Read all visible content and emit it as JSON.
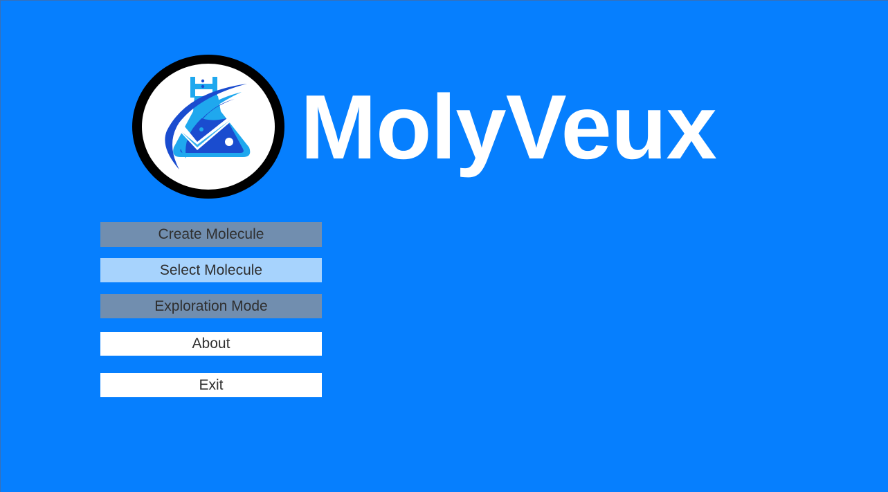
{
  "app": {
    "title": "MolyVeux",
    "logo_icon": "flask-check-logo-icon"
  },
  "menu": {
    "items": [
      {
        "label": "Create Molecule",
        "state": "disabled"
      },
      {
        "label": "Select Molecule",
        "state": "highlighted"
      },
      {
        "label": "Exploration Mode",
        "state": "disabled"
      },
      {
        "label": "About",
        "state": "normal"
      },
      {
        "label": "Exit",
        "state": "normal"
      }
    ]
  },
  "colors": {
    "background": "#067ffe",
    "title": "#ffffff",
    "button_disabled": "#718eaf",
    "button_highlighted": "#a7d3fd",
    "button_normal": "#ffffff",
    "button_text": "#2f2f2f"
  }
}
